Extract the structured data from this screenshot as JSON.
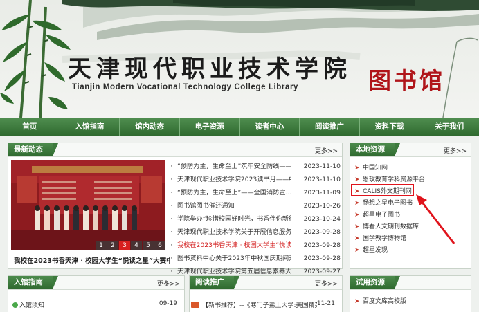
{
  "header": {
    "title_cn": "天津现代职业技术学院",
    "title_en": "Tianjin Modern Vocational Technology College Library",
    "seal": "图书馆"
  },
  "nav": [
    "首页",
    "入馆指南",
    "馆内动态",
    "电子资源",
    "读者中心",
    "阅读推广",
    "资料下载",
    "关于我们"
  ],
  "news": {
    "title": "最新动态",
    "more": "更多>>",
    "photo_caption": "我校在2023书香天津 · 校园大学生“悦读之星”大赛中...",
    "pager": [
      "1",
      "2",
      "3",
      "4",
      "5",
      "6"
    ],
    "active_page": "3",
    "items": [
      {
        "title": "“预防为主，生命至上”筑牢安全防线——...",
        "date": "2023-11-10"
      },
      {
        "title": "天津现代职业技术学院2023读书月——中华...",
        "date": "2023-11-10"
      },
      {
        "title": "“预防为主，生命至上”——全国消防宣...",
        "date": "2023-11-09"
      },
      {
        "title": "图书馆图书催还通知",
        "date": "2023-10-26"
      },
      {
        "title": "学院举办“珍惜校园好时光，书香伴你新征...",
        "date": "2023-10-24"
      },
      {
        "title": "天津现代职业技术学院关于开展信息服务月...",
        "date": "2023-09-28"
      },
      {
        "title": "我校在2023书香天津 · 校园大学生“悦读之...",
        "date": "2023-09-28"
      },
      {
        "title": "图书资料中心关于2023年中秋国庆期间开馆...",
        "date": "2023-09-28"
      },
      {
        "title": "天津现代职业技术学院第五届信息素养大赛...",
        "date": "2023-09-27"
      }
    ]
  },
  "local_res": {
    "title": "本地资源",
    "more": "更多>>",
    "items": [
      "中国知网",
      "恩玫教育学科资源平台",
      "CALIS外文期刊网",
      "畅想之星电子图书",
      "超星电子图书",
      "博看人文期刊数据库",
      "国学教学博物馆",
      "超星发现"
    ]
  },
  "guide": {
    "title": "入馆指南",
    "more": "更多>>",
    "items": [
      {
        "title": "入馆须知",
        "date": "09-19"
      }
    ]
  },
  "reading": {
    "title": "阅读推广",
    "more": "更多>>",
    "items": [
      {
        "title": "【新书推荐】--《寒门子弟上大学:美国精英...",
        "date": "11-21"
      }
    ]
  },
  "trial_res": {
    "title": "试用资源",
    "items": [
      "百度文库高校版"
    ]
  },
  "colors": {
    "nav_green": "#3e7b3e",
    "title_green": "#2f6a2f",
    "highlight_red": "#e0141c",
    "seal_red": "#b0151a"
  }
}
